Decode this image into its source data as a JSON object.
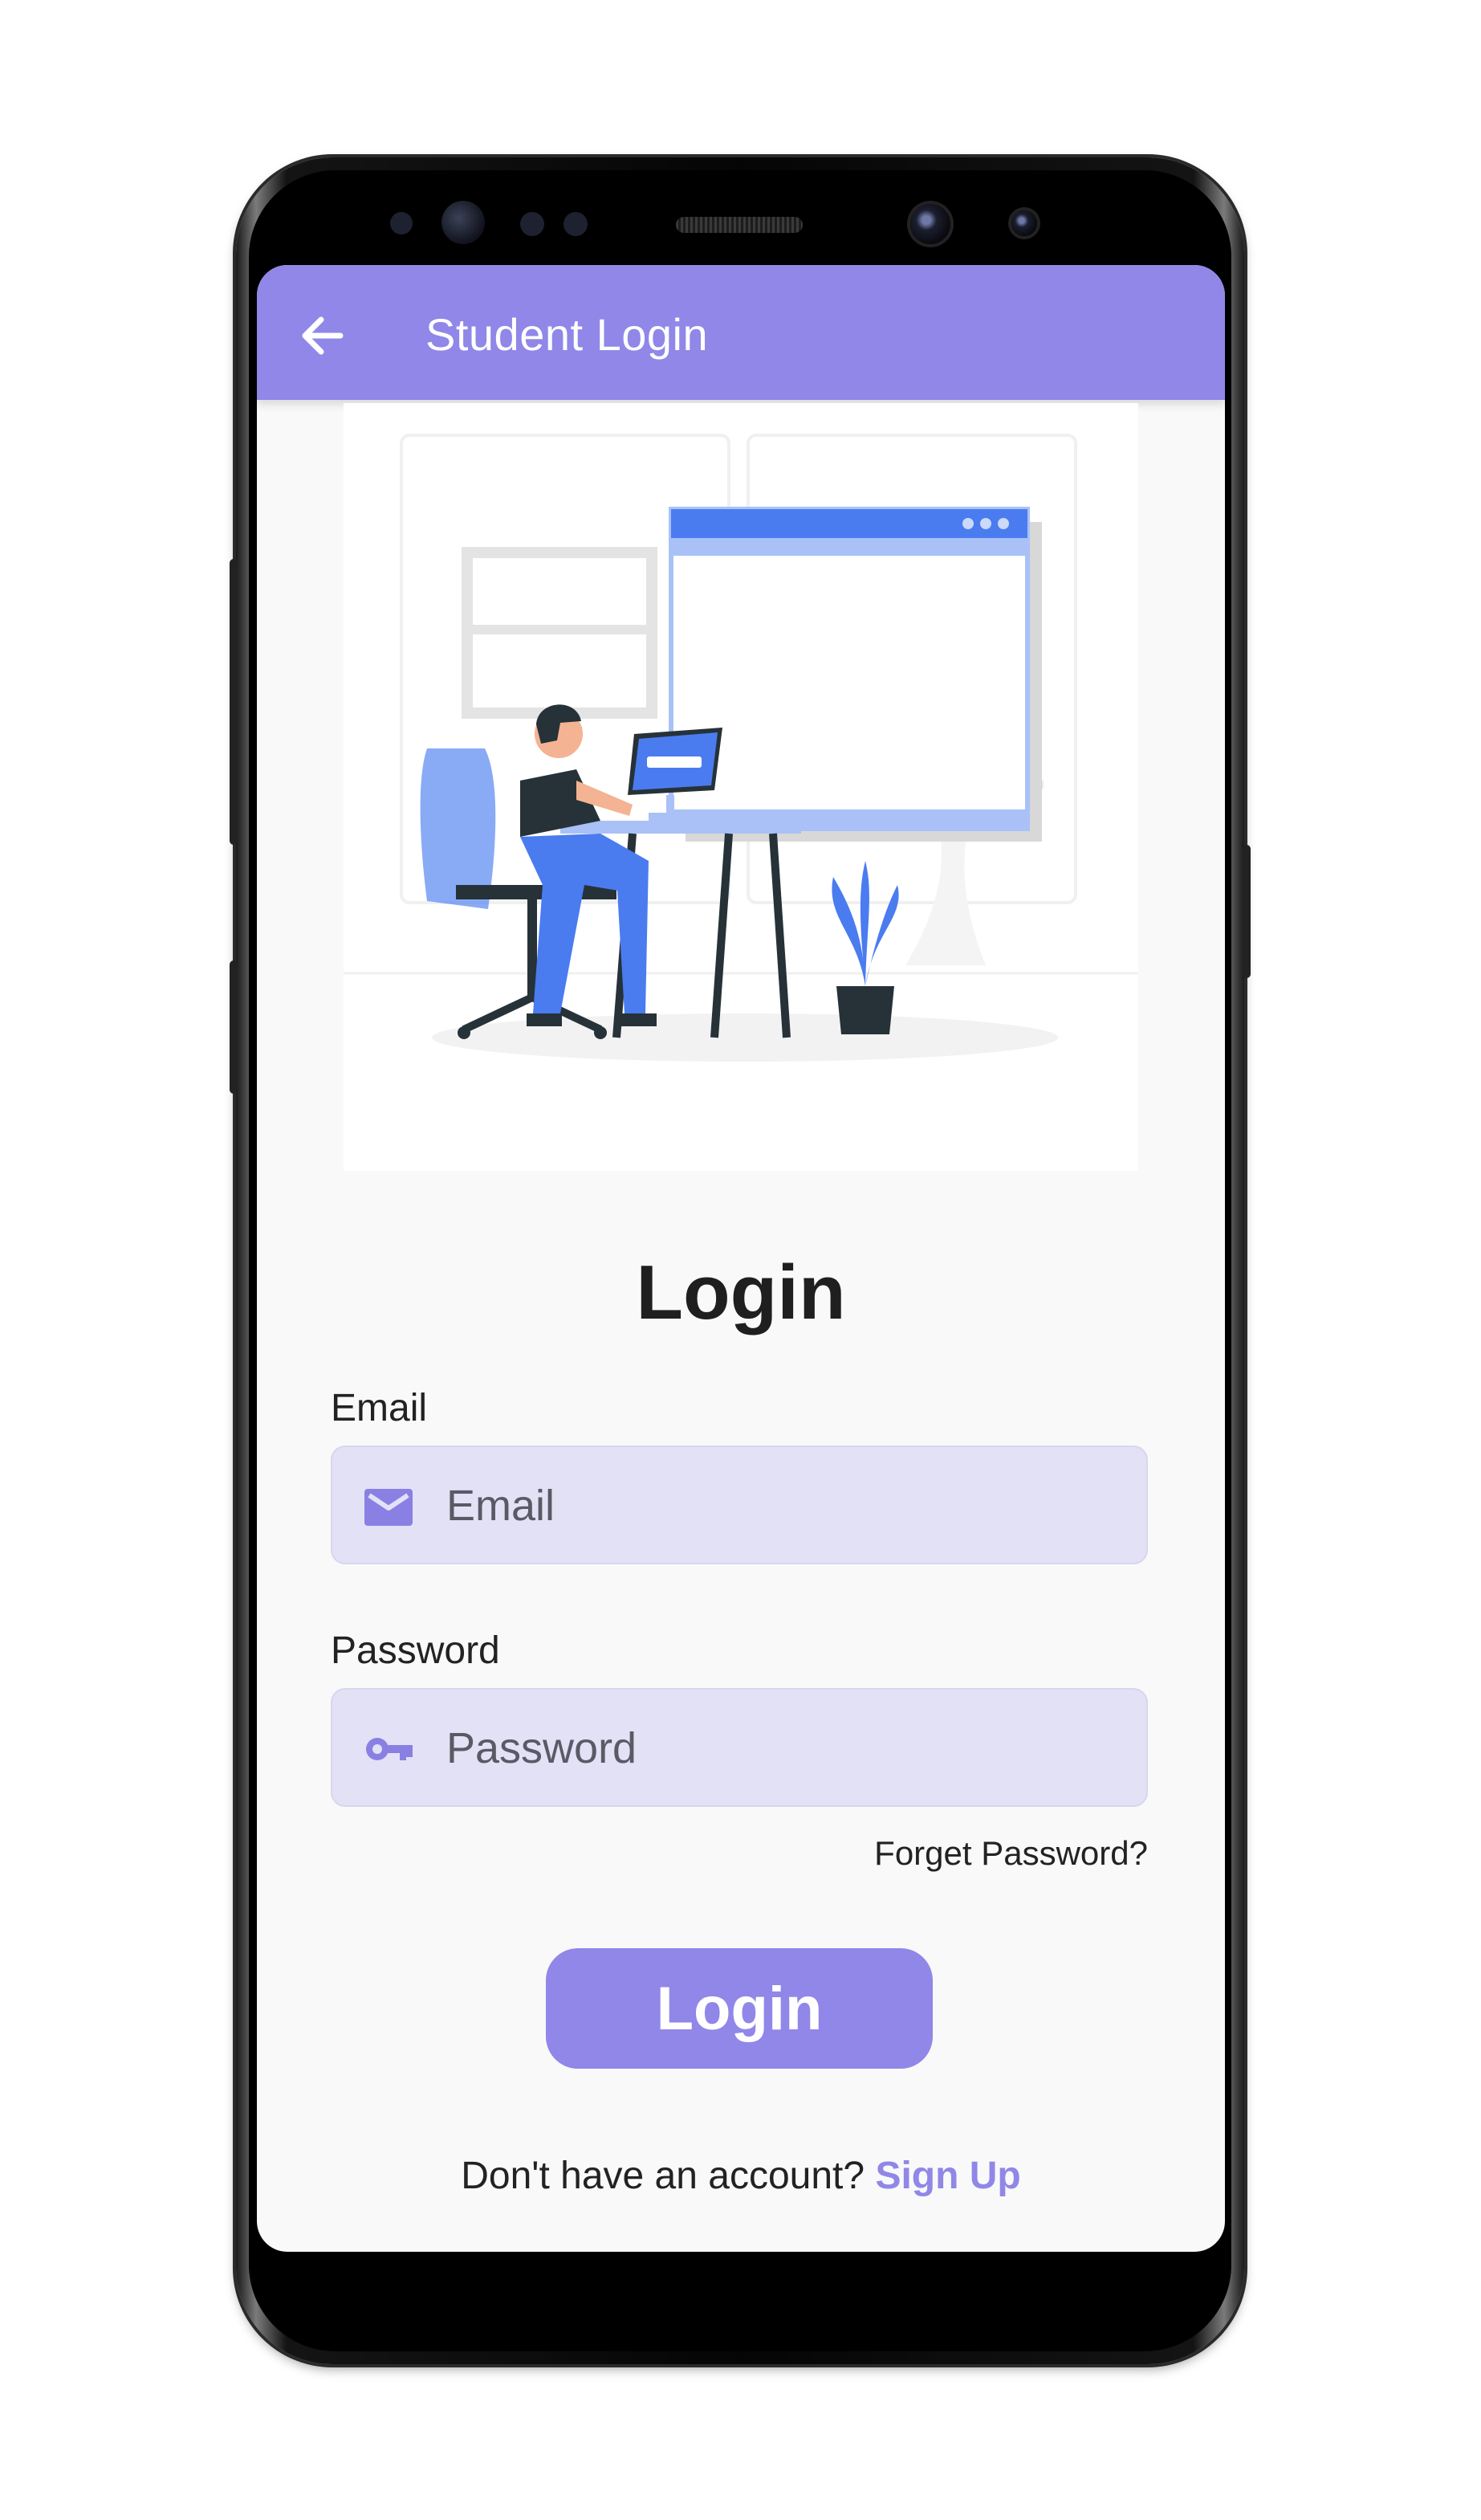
{
  "appbar": {
    "title": "Student Login"
  },
  "main": {
    "heading": "Login",
    "email": {
      "label": "Email",
      "placeholder": "Email",
      "icon": "mail-icon"
    },
    "password": {
      "label": "Password",
      "placeholder": "Password",
      "icon": "key-icon"
    },
    "forgot_password": "Forget Password?",
    "login_button": "Login",
    "signup_prompt": "Don't have an account?",
    "signup_link": "Sign Up"
  },
  "colors": {
    "accent": "#9087e8",
    "field_bg": "#e3e1f5",
    "screen_bg": "#f9f9f9",
    "illustration_blue": "#4a7cf0"
  }
}
